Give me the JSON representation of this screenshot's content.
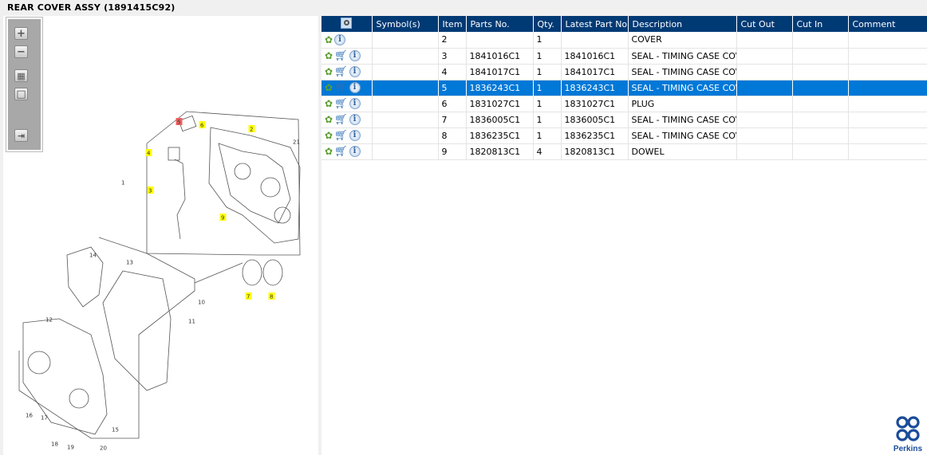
{
  "title": "REAR COVER ASSY (1891415C92)",
  "zoom_tools": {
    "zoom_in": "+",
    "zoom_out": "−",
    "fit": "▦",
    "actual": "□",
    "export": "⇥"
  },
  "diagram": {
    "callouts": [
      "1",
      "2",
      "3",
      "4",
      "5",
      "6",
      "7",
      "8",
      "9",
      "10",
      "11",
      "12",
      "13",
      "14",
      "15",
      "16",
      "17",
      "18",
      "19",
      "20",
      "21"
    ],
    "highlighted": [
      "2",
      "3",
      "4",
      "6",
      "7",
      "8",
      "9"
    ],
    "selected": "5"
  },
  "table": {
    "columns": [
      "",
      "Symbol(s)",
      "Item",
      "Parts No.",
      "Qty.",
      "Latest Part No.",
      "Description",
      "Cut Out",
      "Cut In",
      "Comment"
    ],
    "rows": [
      {
        "item": "2",
        "parts_no": "",
        "qty": "1",
        "latest": "",
        "description": "COVER",
        "cart": false
      },
      {
        "item": "3",
        "parts_no": "1841016C1",
        "qty": "1",
        "latest": "1841016C1",
        "description": "SEAL - TIMING CASE COVE",
        "cart": true
      },
      {
        "item": "4",
        "parts_no": "1841017C1",
        "qty": "1",
        "latest": "1841017C1",
        "description": "SEAL - TIMING CASE COVE",
        "cart": true
      },
      {
        "item": "5",
        "parts_no": "1836243C1",
        "qty": "1",
        "latest": "1836243C1",
        "description": "SEAL - TIMING CASE COVE",
        "cart": true,
        "selected": true
      },
      {
        "item": "6",
        "parts_no": "1831027C1",
        "qty": "1",
        "latest": "1831027C1",
        "description": "PLUG",
        "cart": true
      },
      {
        "item": "7",
        "parts_no": "1836005C1",
        "qty": "1",
        "latest": "1836005C1",
        "description": "SEAL - TIMING CASE COVE",
        "cart": true
      },
      {
        "item": "8",
        "parts_no": "1836235C1",
        "qty": "1",
        "latest": "1836235C1",
        "description": "SEAL - TIMING CASE COVE",
        "cart": true
      },
      {
        "item": "9",
        "parts_no": "1820813C1",
        "qty": "4",
        "latest": "1820813C1",
        "description": "DOWEL",
        "cart": true
      }
    ]
  },
  "logo": {
    "text": "Perkins"
  },
  "colors": {
    "header": "#003a75",
    "selected": "#0078d7",
    "highlight": "#ffff00",
    "selected_callout": "#f06060"
  }
}
